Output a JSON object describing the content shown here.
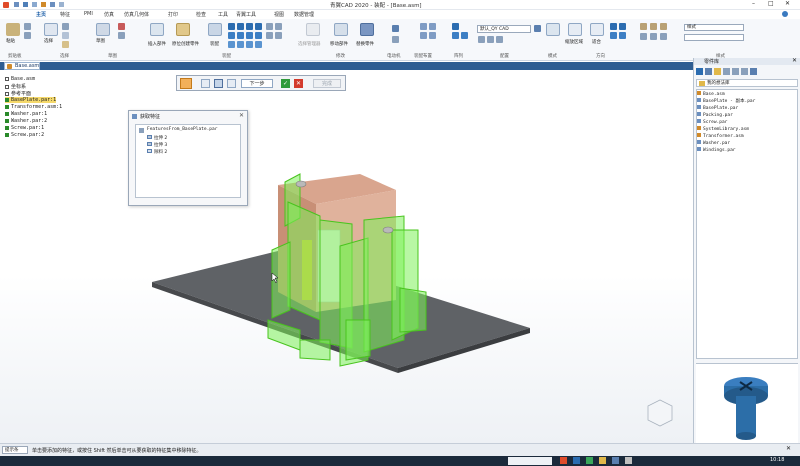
{
  "title_bar": {
    "title": "青翼CAD 2020 - 装配 - [Base.asm]",
    "controls": [
      "–",
      "□",
      "✕"
    ]
  },
  "menu": {
    "items": [
      "主页",
      "特征",
      "PMI",
      "仿真",
      "仿真几何体",
      "打印",
      "检查",
      "工具",
      "青翼工具",
      "视图",
      "数据管理"
    ],
    "active_index": 0
  },
  "ribbon": {
    "groups": [
      {
        "label": "剪贴板"
      },
      {
        "label": "选择"
      },
      {
        "label": "草图"
      },
      {
        "label": "装配"
      },
      {
        "label": "修改"
      },
      {
        "label": "电动机"
      },
      {
        "label": "装配布置"
      },
      {
        "label": "阵列"
      },
      {
        "label": "配置"
      },
      {
        "label": "模式"
      },
      {
        "label": "方向"
      },
      {
        "label": "样式"
      }
    ],
    "tools": {
      "paste": "粘贴",
      "select": "选择",
      "sketch": "草图",
      "insert_component": "插入部件",
      "place_create": "原位创建零件",
      "assembly": "装配",
      "move_component": "移动部件",
      "replace_component": "替换零件",
      "selection_manager": "选择管理器",
      "scope": "scope",
      "zoom_area": "缩放区域",
      "fit": "适合",
      "config_value": "默认_QY CAD",
      "style_value": "样式"
    }
  },
  "doc_tab": {
    "label": "Base.asm"
  },
  "tree": {
    "rows": [
      {
        "label": "Base.asm",
        "checked": false
      },
      {
        "label": "坐标系",
        "checked": false
      },
      {
        "label": "参考平面",
        "checked": false
      },
      {
        "label": "BasePlate.par:1",
        "checked": true,
        "highlight": true
      },
      {
        "label": "Transformer.asm:1",
        "checked": true
      },
      {
        "label": "Washer.par:1",
        "checked": true
      },
      {
        "label": "Washer.par:2",
        "checked": true
      },
      {
        "label": "Screw.par:1",
        "checked": true
      },
      {
        "label": "Screw.par:2",
        "checked": true
      }
    ]
  },
  "command_bar": {
    "next_label": "下一步",
    "finish_label": "完成"
  },
  "dialog": {
    "title": "获取特征",
    "root": "FeaturesFrom_BasePlate.par",
    "features": [
      "拉伸 2",
      "拉伸 3",
      "除料 2"
    ]
  },
  "library": {
    "title": "零件库",
    "folder": "我的想法库",
    "files": [
      "Base.asm",
      "BasePlate - 副本.par",
      "BasePlate.par",
      "Packing.par",
      "Screw.par",
      "SystemLibrary.asm",
      "Transformer.asm",
      "Washer.par",
      "Windings.par"
    ]
  },
  "status": {
    "prompt_tab": "提示条",
    "message": "单击要添加的特征，或按住 Shift 然后单击可从要获取的特征集中移除特征。"
  },
  "taskbar": {
    "search_text": "",
    "time": "10:18"
  },
  "colors": {
    "accent": "#2e5d92",
    "highlight_green": "#7ef05a",
    "plate": "#5f6266",
    "copper": "#d9a58e",
    "preview_blue": "#2c6ea8"
  }
}
